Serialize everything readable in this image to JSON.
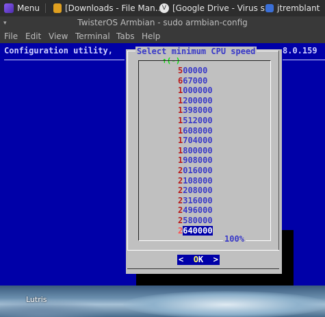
{
  "taskbar": {
    "menu_label": "Menu",
    "task1": "[Downloads - File Man...",
    "task2": "[Google Drive - Virus s...",
    "task3": "jtremblant"
  },
  "window": {
    "title": "TwisterOS Armbian - sudo armbian-config"
  },
  "menubar": [
    "File",
    "Edit",
    "View",
    "Terminal",
    "Tabs",
    "Help"
  ],
  "terminal": {
    "header_left": "Configuration utility,",
    "header_right": "8.0.159"
  },
  "dialog": {
    "title": "Select minimum CPU speed",
    "scroll_indicator": "↑(-)",
    "percent": "100%",
    "ok_left": "<  ",
    "ok_hot": "O",
    "ok_rest": "K  >",
    "items": [
      {
        "hot": "5",
        "rest": "00000"
      },
      {
        "hot": "6",
        "rest": "67000"
      },
      {
        "hot": "1",
        "rest": "000000"
      },
      {
        "hot": "1",
        "rest": "200000"
      },
      {
        "hot": "1",
        "rest": "398000"
      },
      {
        "hot": "1",
        "rest": "512000"
      },
      {
        "hot": "1",
        "rest": "608000"
      },
      {
        "hot": "1",
        "rest": "704000"
      },
      {
        "hot": "1",
        "rest": "800000"
      },
      {
        "hot": "1",
        "rest": "908000"
      },
      {
        "hot": "2",
        "rest": "016000"
      },
      {
        "hot": "2",
        "rest": "108000"
      },
      {
        "hot": "2",
        "rest": "208000"
      },
      {
        "hot": "2",
        "rest": "316000"
      },
      {
        "hot": "2",
        "rest": "496000"
      },
      {
        "hot": "2",
        "rest": "580000"
      },
      {
        "hot": "2",
        "rest": "640000"
      }
    ],
    "selected_index": 16
  },
  "desktop": {
    "lutris_label": "Lutris"
  },
  "colors": {
    "terminal_bg": "#0000a8",
    "dialog_bg": "#c0c0c0",
    "list_text": "#3838c8",
    "hotkey": "#b81818",
    "highlight": "#ffff60"
  }
}
